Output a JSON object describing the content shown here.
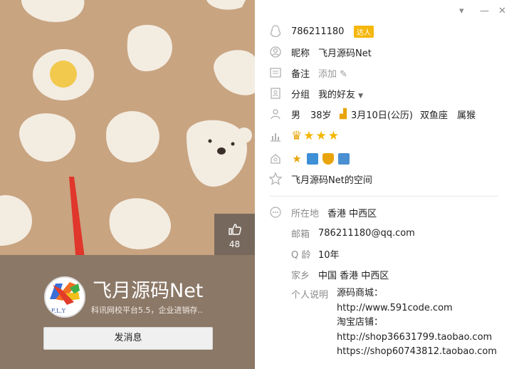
{
  "window": {
    "menu_icon": "chevron-down-icon",
    "minimize_icon": "minimize-icon",
    "close_icon": "close-icon"
  },
  "card": {
    "nickname": "飞月源码Net",
    "signature": "科讯网校平台5.5，企业进销存..",
    "likes": "48",
    "send_message": "发消息",
    "colors": {
      "background": "#c8a481",
      "card_bottom": "#8c7867",
      "bun": "#f3ece1",
      "egg_yolk": "#f2c94c",
      "arrow": "#e0362b"
    }
  },
  "profile": {
    "qq_number": "786211180",
    "qq_badge": "达人",
    "nickname_label": "昵称",
    "nickname_value": "飞月源码Net",
    "remark_label": "备注",
    "remark_value": "添加",
    "group_label": "分组",
    "group_value": "我的好友",
    "gender": "男",
    "age": "38岁",
    "birthday": "3月10日(公历)",
    "zodiac": "双鱼座",
    "chinese_zodiac": "属猴",
    "space_link": "飞月源码Net的空间"
  },
  "details": {
    "location_label": "所在地",
    "location_value": "香港 中西区",
    "email_label": "邮箱",
    "email_value": "786211180@qq.com",
    "qage_label": "Q 龄",
    "qage_value": "10年",
    "hometown_label": "家乡",
    "hometown_value": "中国 香港 中西区",
    "bio_label": "个人说明",
    "bio_lines": [
      "源码商城：",
      "http://www.591code.com",
      "淘宝店铺：",
      "http://shop36631799.taobao.com",
      "https://shop60743812.taobao.com"
    ]
  }
}
